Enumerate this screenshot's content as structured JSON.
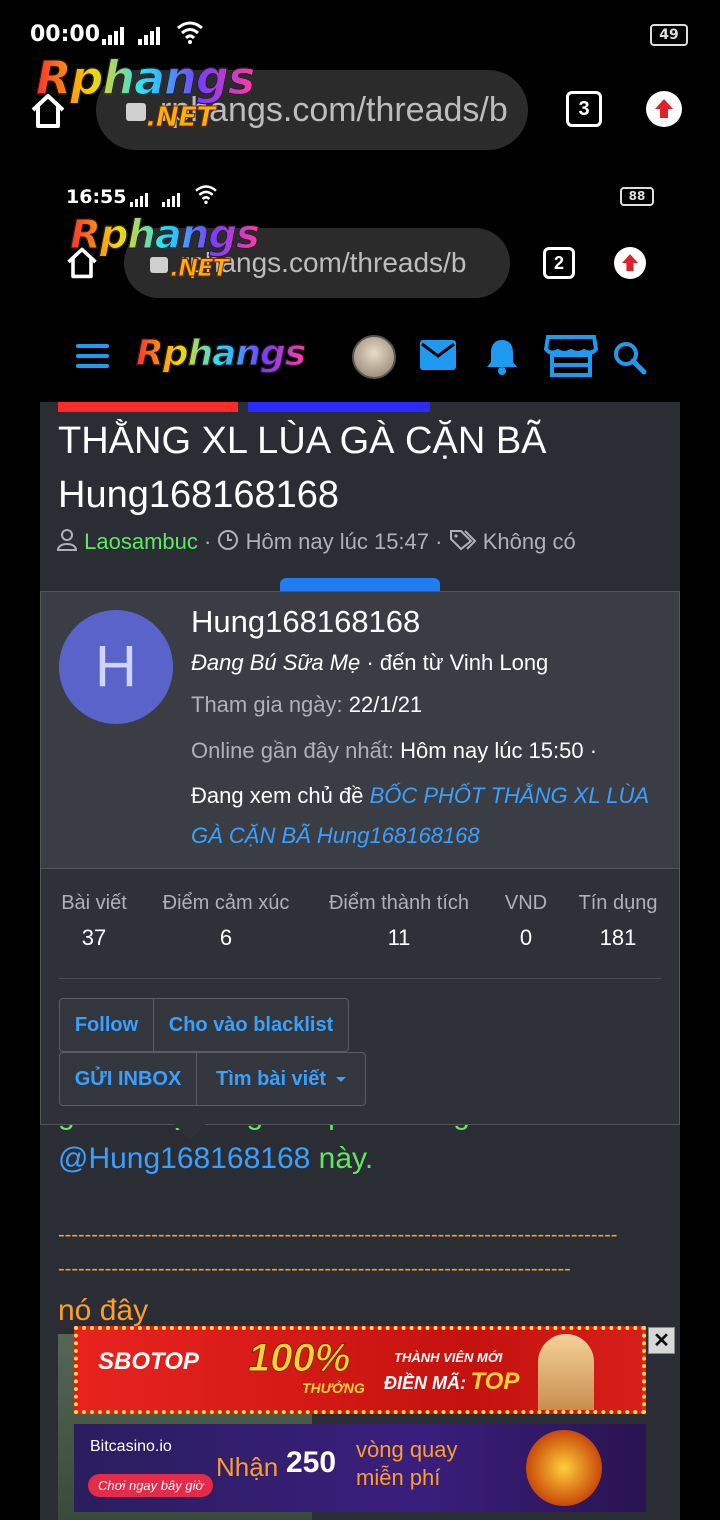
{
  "status_top": {
    "time": "00:00",
    "battery": "49"
  },
  "browser_top": {
    "url": "rphangs.com/threads/b",
    "tabs": "3"
  },
  "status_inner": {
    "time": "16:55",
    "battery": "88"
  },
  "browser_inner": {
    "url": "rphangs.com/threads/b",
    "tabs": "2"
  },
  "logo": {
    "main": "Rphangs",
    "suffix": ".NET"
  },
  "site_header": {
    "logo": "Rphangs"
  },
  "thread": {
    "title": "THẰNG XL LÙA GÀ CẶN BÃ Hung168168168",
    "author": "Laosambuc",
    "time": "Hôm nay lúc 15:47",
    "tags": "Không có"
  },
  "profile": {
    "avatar_letter": "H",
    "avatar_color": "#5a63c9",
    "username": "Hung168168168",
    "user_title": "Đang Bú Sữa Mẹ",
    "from_text": "· đến từ Vinh Long",
    "joined_label": "Tham gia ngày:",
    "joined_value": "22/1/21",
    "online_label": "Online gần đây nhất:",
    "online_value": "Hôm nay lúc 15:50 ·",
    "viewing_label": "Đang xem chủ đề",
    "viewing_thread": "BỐC PHỐT THẰNG XL LÙA GÀ CẶN BÃ Hung168168168",
    "stats": [
      {
        "label": "Bài viết",
        "value": "37"
      },
      {
        "label": "Điểm cảm xúc",
        "value": "6"
      },
      {
        "label": "Điểm thành tích",
        "value": "11"
      },
      {
        "label": "VND",
        "value": "0"
      },
      {
        "label": "Tín dụng",
        "value": "181"
      }
    ],
    "buttons": {
      "follow": "Follow",
      "blacklist": "Cho vào blacklist",
      "inbox": "GỬI INBOX",
      "find_posts": "Tìm bài viết"
    }
  },
  "post": {
    "obscured_line": "ga rồi này cũng bóc phốt thằng xl",
    "mention": "@Hung168168168",
    "mention_suffix": " này.",
    "dashes1": "------------------------------------------------------------------------------------",
    "dashes2": "-----------------------------------------------------------------------------",
    "text": "nó đây"
  },
  "ads": {
    "sbotop": {
      "brand": "SBOTOP",
      "percent": "100%",
      "bonus": "THƯỞNG",
      "member": "THÀNH VIÊN MỚI",
      "code_label": "ĐIỀN MÃ:",
      "code": "TOP"
    },
    "bitcasino": {
      "brand": "Bitcasino.io",
      "cta": "Chơi ngay bây giờ",
      "receive": "Nhận",
      "amount": "250",
      "spins_line1": "vòng quay",
      "spins_line2": "miễn phí"
    },
    "close": "✕"
  }
}
